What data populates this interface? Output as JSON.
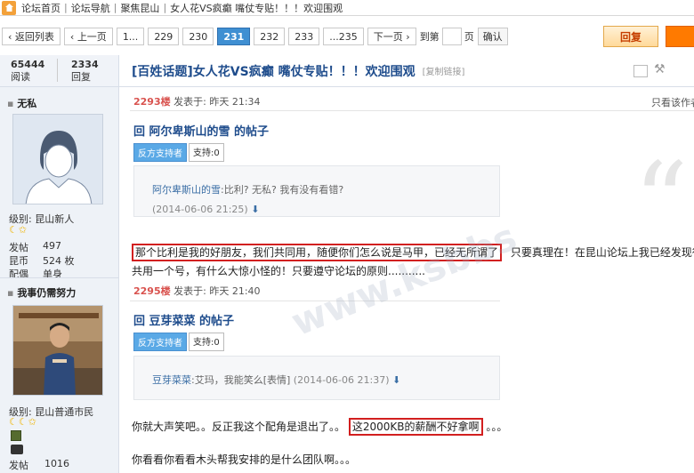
{
  "breadcrumb": [
    "论坛首页",
    "论坛导航",
    "聚焦昆山",
    "女人花VS疯癫 嘴仗专贴！！！欢迎围观"
  ],
  "pager": {
    "back": "返回列表",
    "prev": "上一页",
    "pages": [
      "1...",
      "229",
      "230",
      "231",
      "232",
      "233",
      "...235"
    ],
    "current": "231",
    "next": "下一页",
    "goto_pre": "到第",
    "goto_post": "页",
    "confirm": "确认",
    "reply": "回复"
  },
  "stats": {
    "views": "65444",
    "views_label": "阅读",
    "replies": "2334",
    "replies_label": "回复"
  },
  "thread": {
    "title": "[百姓话题]女人花VS疯癫 嘴仗专贴！！！欢迎围观",
    "copy_link": "[复制链接]"
  },
  "only_author": "只看该作者",
  "user1": {
    "name": "无私",
    "level_label": "级别:",
    "level": "昆山新人",
    "stars": "☾✩",
    "posts_label": "发帖",
    "posts": "497",
    "coins_label": "昆币",
    "coins": "524 枚",
    "partner_label": "配偶",
    "partner": "单身"
  },
  "user2": {
    "name": "我事仍需努力",
    "level_label": "级别:",
    "level": "昆山普通市民",
    "stars": "☾☾✩",
    "posts_label": "发帖",
    "posts": "1016"
  },
  "post1": {
    "floor": "2293楼",
    "posted": "发表于: 昨天 21:34",
    "reply_title": "回 阿尔卑斯山的雪 的帖子",
    "support_a": "反方支持者",
    "support_b": "支持:0",
    "quote_name": "阿尔卑斯山的雪",
    "quote_text": ":比利? 无私? 我有没有看错?",
    "quote_time": "(2014-06-06 21:25)",
    "highlight": "那个比利是我的好朋友，我们共同用，随便你们怎么说是马甲，已经无所谓了",
    "line1_rest": "只要真理在！在昆山论坛上我已经发现很多人",
    "line2": "共用一个号，有什么大惊小怪的！只要遵守论坛的原则..........."
  },
  "post2": {
    "floor": "2295楼",
    "posted": "发表于: 昨天 21:40",
    "reply_title": "回 豆芽菜菜 的帖子",
    "support_a": "反方支持者",
    "support_b": "支持:0",
    "quote_name": "豆芽菜菜",
    "quote_text": ":艾玛，我能笑么[表情]",
    "quote_time": "(2014-06-06 21:37)",
    "line1_pre": "你就大声笑吧。。反正我这个配角是退出了。。",
    "highlight": "这2000KB的薪酬不好拿啊",
    "line1_post": "。。。",
    "line2": "你看看你看看木头帮我安排的是什么团队啊。。。"
  },
  "watermark": "www.ksbbs"
}
